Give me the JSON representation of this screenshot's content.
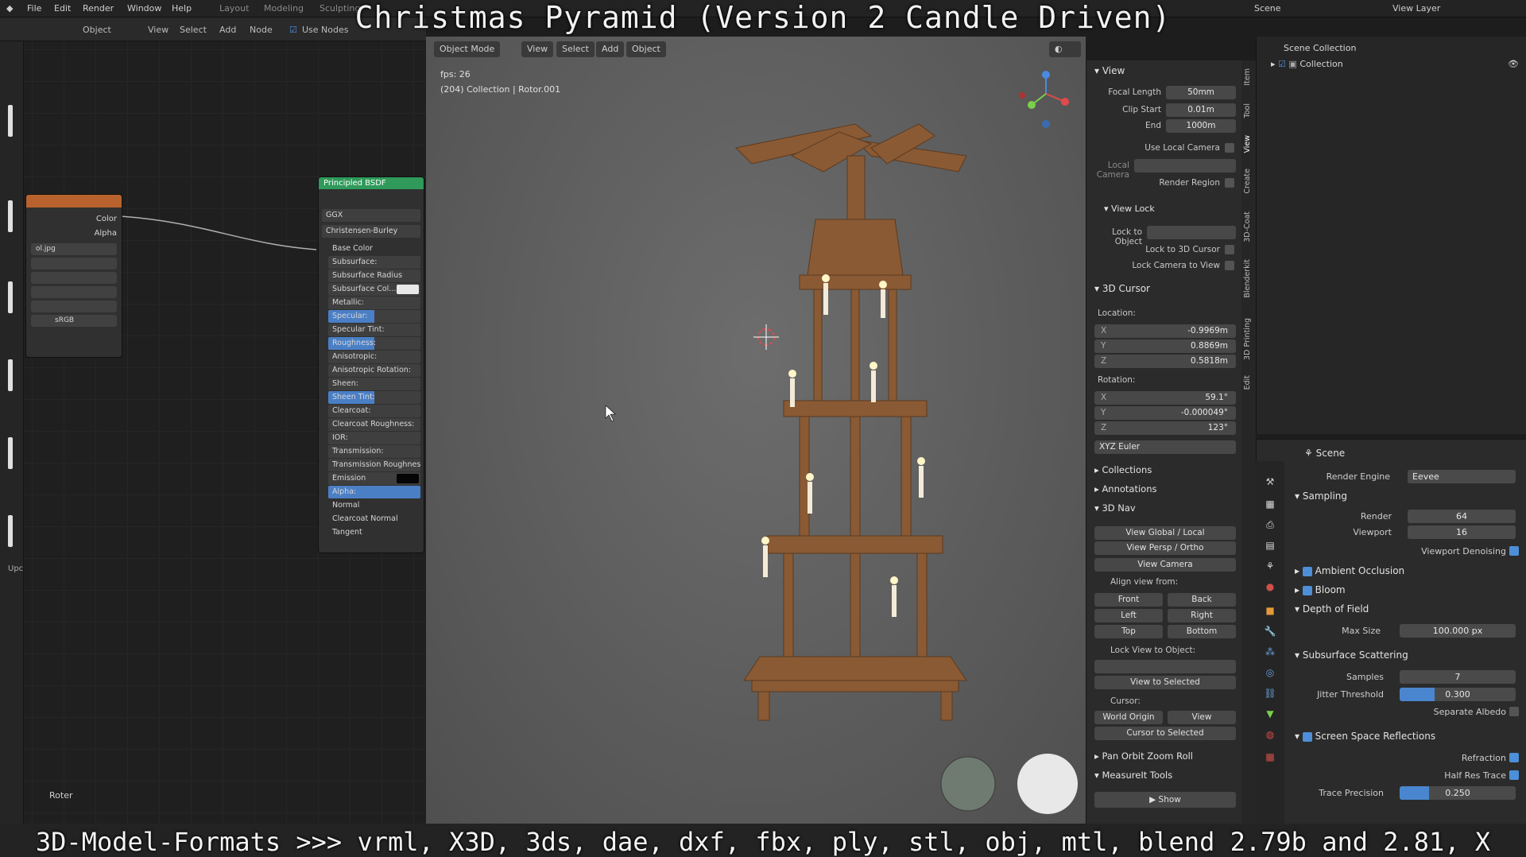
{
  "top_menu": [
    "File",
    "Edit",
    "Render",
    "Window",
    "Help",
    "Layout",
    "Modeling",
    "Sculpting"
  ],
  "top_right": {
    "scene": "Scene",
    "view_layer": "View Layer"
  },
  "overlay": {
    "title": "Christmas Pyramid (Version 2 Candle Driven)",
    "subtitle": "3D-Model-Formats >>> vrml, X3D, 3ds, dae, dxf, fbx, ply, stl, obj, mtl, blend 2.79b and 2.81, X"
  },
  "node_editor": {
    "header": [
      "Object",
      "View",
      "Select",
      "Add",
      "Node",
      "Use Nodes"
    ],
    "image_node": {
      "outputs": [
        "Color",
        "Alpha"
      ],
      "file": "ol.jpg",
      "colorspace": "sRGB"
    },
    "bsdf": {
      "title": "Principled BSDF",
      "distribution": "GGX",
      "subsurface_method": "Christensen-Burley",
      "inputs": [
        {
          "label": "Base Color",
          "style": "plain"
        },
        {
          "label": "Subsurface:",
          "style": "field"
        },
        {
          "label": "Subsurface Radius",
          "style": "field"
        },
        {
          "label": "Subsurface Col...",
          "style": "swatch"
        },
        {
          "label": "Metallic:",
          "style": "field"
        },
        {
          "label": "Specular:",
          "style": "hl",
          "fill": 0.5
        },
        {
          "label": "Specular Tint:",
          "style": "field"
        },
        {
          "label": "Roughness:",
          "style": "hl",
          "fill": 0.5
        },
        {
          "label": "Anisotropic:",
          "style": "field"
        },
        {
          "label": "Anisotropic Rotation:",
          "style": "field"
        },
        {
          "label": "Sheen:",
          "style": "field"
        },
        {
          "label": "Sheen Tint:",
          "style": "hl",
          "fill": 0.5
        },
        {
          "label": "Clearcoat:",
          "style": "field"
        },
        {
          "label": "Clearcoat Roughness:",
          "style": "field"
        },
        {
          "label": "IOR:",
          "style": "field"
        },
        {
          "label": "Transmission:",
          "style": "field"
        },
        {
          "label": "Transmission Roughness:",
          "style": "field"
        },
        {
          "label": "Emission",
          "style": "black"
        },
        {
          "label": "Alpha:",
          "style": "hl",
          "fill": 1.0
        },
        {
          "label": "Normal",
          "style": "plain"
        },
        {
          "label": "Clearcoat Normal",
          "style": "plain"
        },
        {
          "label": "Tangent",
          "style": "plain"
        }
      ]
    },
    "frame_label": "Roter",
    "side_label": "Upc"
  },
  "viewport": {
    "header": [
      "Object Mode",
      "View",
      "Select",
      "Add",
      "Object"
    ],
    "fps": "fps: 26",
    "info": "(204) Collection | Rotor.001"
  },
  "npanel": {
    "view": {
      "title": "View",
      "focal_length_label": "Focal Length",
      "focal_length": "50mm",
      "clip_start_label": "Clip Start",
      "clip_start": "0.01m",
      "end_label": "End",
      "end": "1000m",
      "use_local_camera": "Use Local Camera",
      "local_camera": "Local Camera",
      "render_region": "Render Region"
    },
    "view_lock": {
      "title": "View Lock",
      "lock_to_object": "Lock to Object",
      "lock_to_3d_cursor": "Lock to 3D Cursor",
      "lock_camera_to_view": "Lock Camera to View"
    },
    "cursor": {
      "title": "3D Cursor",
      "location": "Location:",
      "loc": [
        {
          "axis": "X",
          "value": "-0.9969m"
        },
        {
          "axis": "Y",
          "value": "0.8869m"
        },
        {
          "axis": "Z",
          "value": "0.5818m"
        }
      ],
      "rotation": "Rotation:",
      "rot": [
        {
          "axis": "X",
          "value": "59.1°"
        },
        {
          "axis": "Y",
          "value": "-0.000049°"
        },
        {
          "axis": "Z",
          "value": "123°"
        }
      ],
      "mode": "XYZ Euler"
    },
    "collections": "Collections",
    "annotations": "Annotations",
    "nav": {
      "title": "3D Nav",
      "global_local": "View Global / Local",
      "persp_ortho": "View Persp / Ortho",
      "view_camera": "View Camera",
      "align_from": "Align view from:",
      "front": "Front",
      "back": "Back",
      "left": "Left",
      "right": "Right",
      "top": "Top",
      "bottom": "Bottom",
      "lock_view": "Lock View to Object:",
      "view_selected": "View to Selected",
      "cursor": "Cursor:",
      "world_origin": "World Origin",
      "view": "View",
      "cursor_selected": "Cursor to Selected"
    },
    "pan_orbit": "Pan Orbit Zoom Roll",
    "measureit": "MeasureIt Tools",
    "show": "Show",
    "tabs": [
      "Item",
      "Tool",
      "View",
      "Create",
      "3D-Coat",
      "Blenderkit",
      "3D Printing",
      "Edit"
    ]
  },
  "outliner": {
    "scene_collection": "Scene Collection",
    "collection": "Collection"
  },
  "properties": {
    "scene": "Scene",
    "render_engine_label": "Render Engine",
    "render_engine": "Eevee",
    "sampling": "Sampling",
    "render_label": "Render",
    "render": "64",
    "viewport_label": "Viewport",
    "viewport": "16",
    "viewport_denoising": "Viewport Denoising",
    "ambient_occlusion": "Ambient Occlusion",
    "bloom": "Bloom",
    "dof": "Depth of Field",
    "max_size_label": "Max Size",
    "max_size": "100.000 px",
    "sss": "Subsurface Scattering",
    "samples_label": "Samples",
    "samples": "7",
    "jitter_label": "Jitter Threshold",
    "jitter": "0.300",
    "separate_albedo": "Separate Albedo",
    "ssr": "Screen Space Reflections",
    "refraction": "Refraction",
    "half_res": "Half Res Trace",
    "trace_precision_label": "Trace Precision",
    "trace_precision": "0.250"
  },
  "colors": {
    "bsdf_header": "#2f9a5a",
    "image_header": "#b8632e",
    "accent": "#4a86cf"
  }
}
